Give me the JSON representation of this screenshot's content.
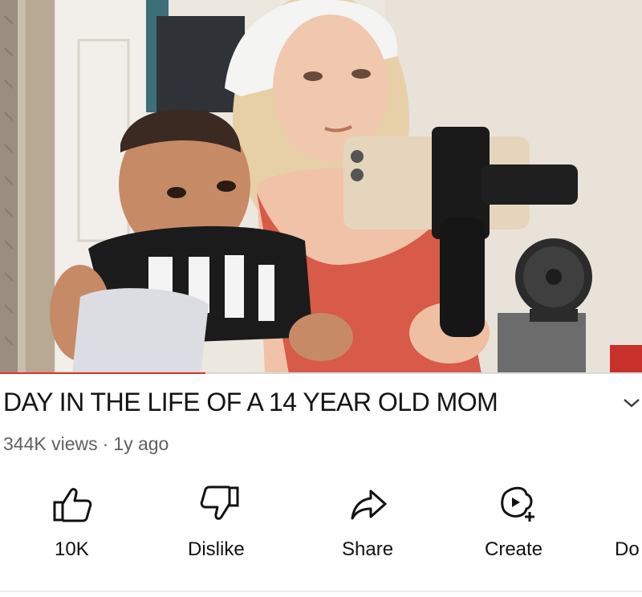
{
  "video": {
    "progress_fraction": 0.32
  },
  "title": "DAY IN THE LIFE OF A 14 YEAR OLD MOM",
  "meta": {
    "views": "344K views",
    "separator": "·",
    "age": "1y ago"
  },
  "icons": {
    "expand": "chevron-down-icon",
    "like": "thumbs-up-icon",
    "dislike": "thumbs-down-icon",
    "share": "share-arrow-icon",
    "create": "create-sparkle-icon"
  },
  "actions": {
    "like_count": "10K",
    "dislike_label": "Dislike",
    "share_label": "Share",
    "create_label": "Create",
    "download_label": "Do"
  },
  "colors": {
    "progress": "#e52d27",
    "text": "#0f0f0f",
    "meta_text": "#606060"
  }
}
